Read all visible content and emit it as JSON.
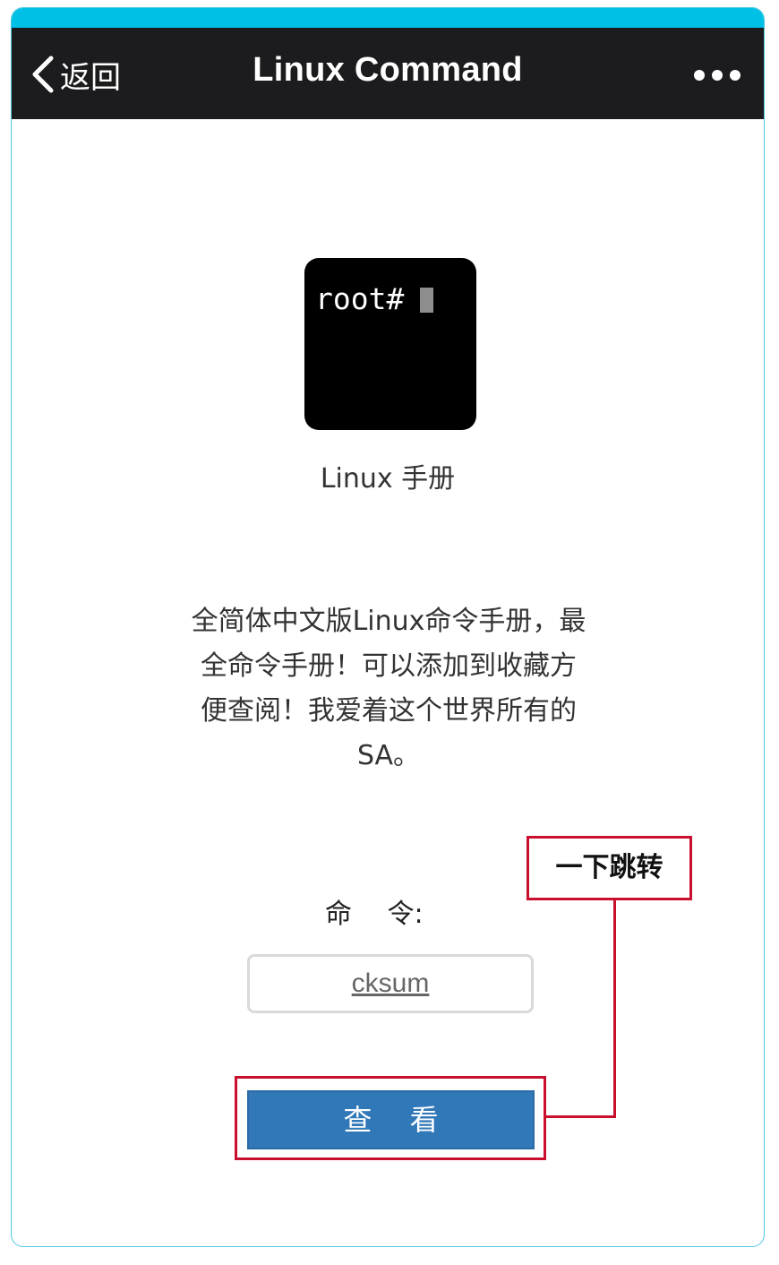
{
  "nav": {
    "back_label": "返回",
    "title": "Linux Command",
    "more_icon": "more-horizontal-icon"
  },
  "logo": {
    "text": "root#"
  },
  "app_name": "Linux 手册",
  "description": "全简体中文版Linux命令手册，最全命令手册！可以添加到收藏方便查阅！我爱着这个世界所有的SA。",
  "form": {
    "command_label": "命　 令:",
    "command_value": "cksum",
    "view_button_label": "查　 看"
  },
  "annotation": {
    "label": "一下跳转"
  },
  "colors": {
    "top_strip": "#00c0e6",
    "nav_background": "#1c1c1e",
    "button_blue": "#3178b8",
    "annotation_red": "#c8102e"
  }
}
